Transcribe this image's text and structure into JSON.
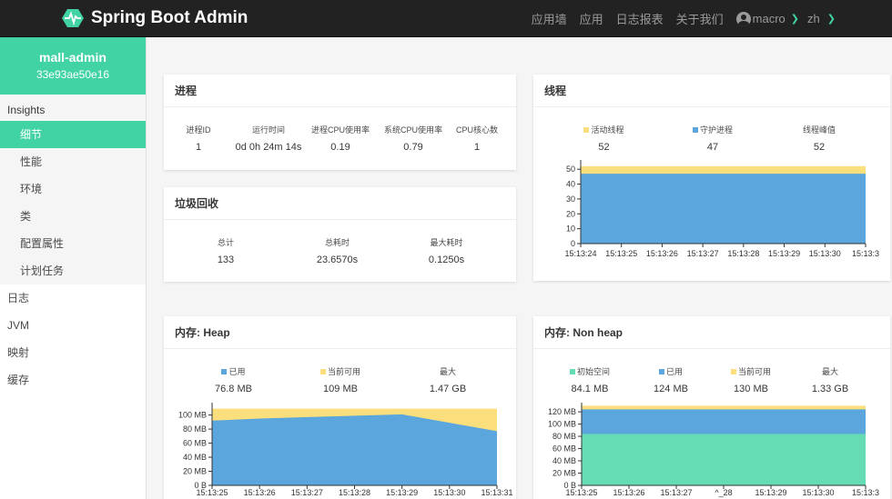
{
  "header": {
    "brand": "Spring Boot Admin",
    "nav": [
      "应用墙",
      "应用",
      "日志报表",
      "关于我们"
    ],
    "user": "macro",
    "lang": "zh"
  },
  "sidebar": {
    "app_name": "mall-admin",
    "app_id": "33e93ae50e16",
    "group_title": "Insights",
    "insights": [
      "细节",
      "性能",
      "环境",
      "类",
      "配置属性",
      "计划任务"
    ],
    "top_items": [
      "日志",
      "JVM",
      "映射",
      "缓存"
    ]
  },
  "process": {
    "title": "进程",
    "labels": [
      "进程ID",
      "运行时间",
      "进程CPU使用率",
      "系统CPU使用率",
      "CPU核心数"
    ],
    "values": [
      "1",
      "0d 0h 24m 14s",
      "0.19",
      "0.79",
      "1"
    ]
  },
  "gc": {
    "title": "垃圾回收",
    "labels": [
      "总计",
      "总耗时",
      "最大耗时"
    ],
    "values": [
      "133",
      "23.6570s",
      "0.1250s"
    ]
  },
  "threads": {
    "title": "线程",
    "labels": [
      "活动线程",
      "守护进程",
      "线程峰值"
    ],
    "values": [
      "52",
      "47",
      "52"
    ]
  },
  "heap": {
    "title": "内存: Heap",
    "labels": [
      "已用",
      "当前可用",
      "最大"
    ],
    "values": [
      "76.8 MB",
      "109 MB",
      "1.47 GB"
    ]
  },
  "nonheap": {
    "title": "内存: Non heap",
    "labels": [
      "初始空间",
      "已用",
      "当前可用",
      "最大"
    ],
    "values": [
      "84.1 MB",
      "124 MB",
      "130 MB",
      "1.33 GB"
    ]
  },
  "colors": {
    "accent": "#42d3a5",
    "blue": "#5aa6dd",
    "yellow": "#fbdf7d",
    "green": "#65dcb3",
    "topbar": "#222222"
  },
  "chart_data": [
    {
      "type": "area",
      "title": "线程",
      "x": [
        "15:13:24",
        "15:13:25",
        "15:13:26",
        "15:13:27",
        "15:13:28",
        "15:13:29",
        "15:13:30",
        "15:13:3"
      ],
      "y_ticks": [
        "0",
        "10",
        "20",
        "30",
        "40",
        "50"
      ],
      "ylim": [
        0,
        55
      ],
      "series": [
        {
          "name": "守护进程",
          "color": "#5aa6dd",
          "values": [
            47,
            47,
            47,
            47,
            47,
            47,
            47,
            47
          ]
        },
        {
          "name": "活动线程",
          "color": "#fbdf7d",
          "values": [
            52,
            52,
            52,
            52,
            52,
            52,
            52,
            52
          ]
        }
      ]
    },
    {
      "type": "area",
      "title": "内存: Heap",
      "x": [
        "15:13:25",
        "15:13:26",
        "15:13:27",
        "15:13:28",
        "15:13:29",
        "15:13:30",
        "15:13:31"
      ],
      "y_ticks": [
        "0 B",
        "20 MB",
        "40 MB",
        "60 MB",
        "80 MB",
        "100 MB"
      ],
      "ylim": [
        0,
        115
      ],
      "series": [
        {
          "name": "已用",
          "color": "#5aa6dd",
          "values": [
            92,
            95,
            97,
            99,
            101,
            89,
            77
          ]
        },
        {
          "name": "当前可用",
          "color": "#fbdf7d",
          "values": [
            109,
            109,
            109,
            109,
            109,
            109,
            109
          ]
        }
      ]
    },
    {
      "type": "area",
      "title": "内存: Non heap",
      "x": [
        "15:13:25",
        "15:13:26",
        "15:13:27",
        "^_28",
        "15:13:29",
        "15:13:30",
        "15:13:3"
      ],
      "y_ticks": [
        "0 B",
        "20 MB",
        "40 MB",
        "60 MB",
        "80 MB",
        "100 MB",
        "120 MB"
      ],
      "ylim": [
        0,
        132
      ],
      "series": [
        {
          "name": "初始空间",
          "color": "#65dcb3",
          "values": [
            84,
            84,
            84,
            84,
            84,
            84,
            84
          ]
        },
        {
          "name": "已用",
          "color": "#5aa6dd",
          "values": [
            124,
            124,
            124,
            124,
            124,
            124,
            124
          ]
        },
        {
          "name": "当前可用",
          "color": "#fbdf7d",
          "values": [
            130,
            130,
            130,
            130,
            130,
            130,
            130
          ]
        }
      ]
    }
  ]
}
